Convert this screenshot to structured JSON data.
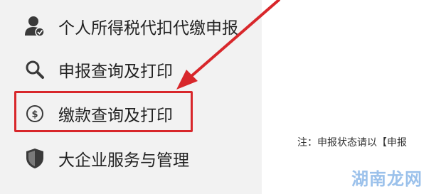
{
  "sidebar": {
    "items": [
      {
        "label": "个人所得税代扣代缴申报",
        "icon": "user-check-icon"
      },
      {
        "label": "申报查询及打印",
        "icon": "search-icon"
      },
      {
        "label": "缴款查询及打印",
        "icon": "dollar-coin-icon",
        "highlighted": true
      },
      {
        "label": "大企业服务与管理",
        "icon": "shield-icon"
      }
    ]
  },
  "main": {
    "note": "注：申报状态请以【申报"
  },
  "annotation": {
    "highlight_color": "#d8272b",
    "arrow_color": "#d8272b"
  },
  "watermark": {
    "text": "湖南龙网"
  }
}
